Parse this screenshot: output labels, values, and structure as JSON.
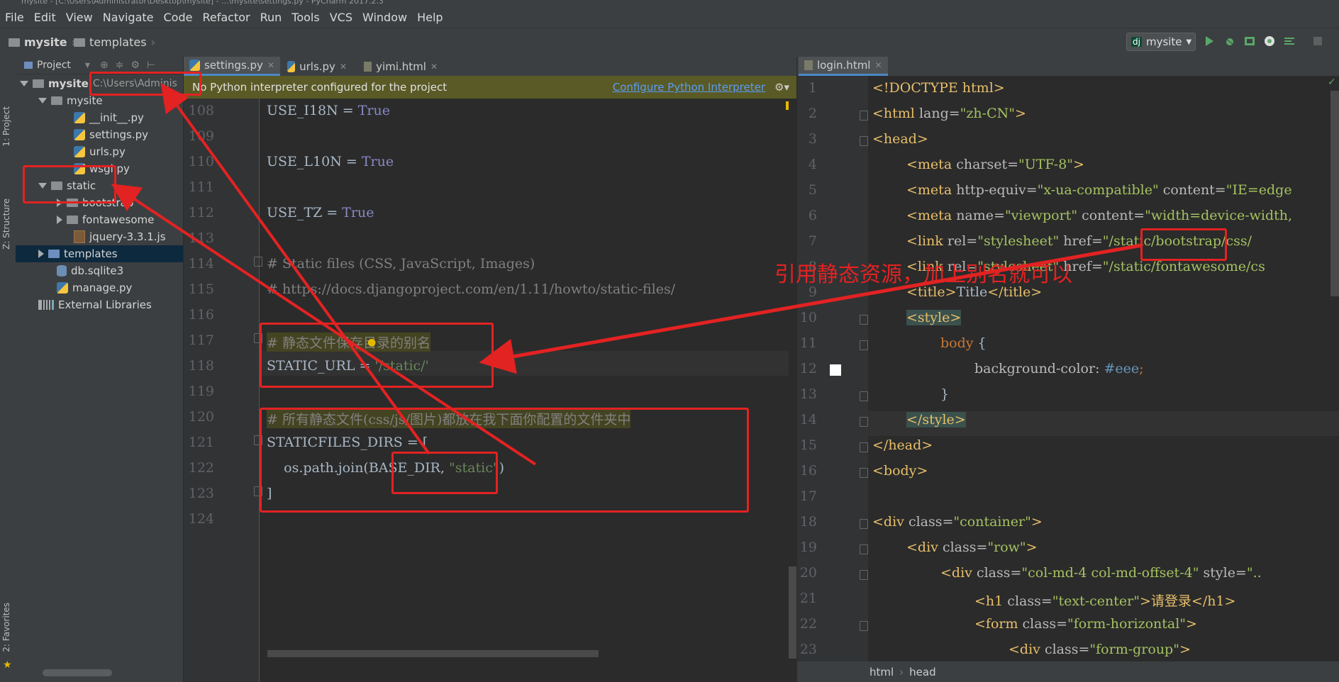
{
  "window": {
    "title": "mysite - [C:\\Users\\Administrator\\Desktop\\mysite] - ...\\mysite\\settings.py - PyCharm 2017.2.3"
  },
  "menu": [
    "File",
    "Edit",
    "View",
    "Navigate",
    "Code",
    "Refactor",
    "Run",
    "Tools",
    "VCS",
    "Window",
    "Help"
  ],
  "breadcrumb": {
    "project": "mysite",
    "folder": "templates"
  },
  "run_config": {
    "label": "mysite"
  },
  "side_tools": {
    "project": "1: Project",
    "structure": "Z: Structure",
    "favorites": "2: Favorites"
  },
  "project_panel": {
    "header": "Project",
    "root": {
      "name": "mysite",
      "path": "C:\\Users\\Adminis"
    },
    "items": [
      {
        "name": "mysite",
        "kind": "folder",
        "indent": 1,
        "expanded": true
      },
      {
        "name": "__init__.py",
        "kind": "py",
        "indent": 2
      },
      {
        "name": "settings.py",
        "kind": "py",
        "indent": 2
      },
      {
        "name": "urls.py",
        "kind": "py",
        "indent": 2
      },
      {
        "name": "wsgi.py",
        "kind": "py",
        "indent": 2
      },
      {
        "name": "static",
        "kind": "folder",
        "indent": 1,
        "expanded": true
      },
      {
        "name": "bootstrap",
        "kind": "folder",
        "indent": 2
      },
      {
        "name": "fontawesome",
        "kind": "folder",
        "indent": 2
      },
      {
        "name": "jquery-3.3.1.js",
        "kind": "js",
        "indent": 2
      },
      {
        "name": "templates",
        "kind": "folder-blue",
        "indent": 1,
        "selected": true
      },
      {
        "name": "db.sqlite3",
        "kind": "db",
        "indent": 1
      },
      {
        "name": "manage.py",
        "kind": "py",
        "indent": 1
      },
      {
        "name": "External Libraries",
        "kind": "lib",
        "indent": 0
      }
    ]
  },
  "editor_left": {
    "tabs": [
      "settings.py",
      "urls.py",
      "yimi.html"
    ],
    "notice": "No Python interpreter configured for the project",
    "notice_link": "Configure Python Interpreter",
    "line_numbers": [
      "108",
      "109",
      "110",
      "111",
      "112",
      "113",
      "114",
      "115",
      "116",
      "117",
      "118",
      "119",
      "120",
      "121",
      "122",
      "123",
      "124"
    ],
    "code": {
      "l108a": "USE_I18N = ",
      "l108b": "True",
      "l110a": "USE_L10N = ",
      "l110b": "True",
      "l112a": "USE_TZ = ",
      "l112b": "True",
      "l114": "# Static files (CSS, JavaScript, Images)",
      "l115": "# https://docs.djangoproject.com/en/1.11/howto/static-files/",
      "l117": "# 静态文件保存目录的别名",
      "l118a": "STATIC_URL = ",
      "l118b": "'/static/'",
      "l120": "# 所有静态文件(css/js/图片)都放在我下面你配置的文件夹中",
      "l121": "STATICFILES_DIRS = [",
      "l122a": "    os.path.join(BASE_DIR, ",
      "l122b": "\"static\"",
      "l122c": ")",
      "l123": "]"
    }
  },
  "editor_right": {
    "tabs": [
      "login.html"
    ],
    "line_numbers": [
      "1",
      "2",
      "3",
      "4",
      "5",
      "6",
      "7",
      "8",
      "9",
      "10",
      "11",
      "12",
      "13",
      "14",
      "15",
      "16",
      "17",
      "18",
      "19",
      "20",
      "21",
      "22",
      "23"
    ],
    "code": {
      "l1": "<!DOCTYPE html>",
      "l2a": "<html ",
      "l2b": "lang=",
      "l2c": "\"zh-CN\"",
      "l2d": ">",
      "l3": "<head>",
      "l4a": "<meta ",
      "l4b": "charset=",
      "l4c": "\"UTF-8\"",
      "l4d": ">",
      "l5a": "<meta ",
      "l5b": "http-equiv=",
      "l5c": "\"x-ua-compatible\"",
      "l5d": " content=",
      "l5e": "\"IE=edge",
      "l6a": "<meta ",
      "l6b": "name=",
      "l6c": "\"viewport\"",
      "l6d": " content=",
      "l6e": "\"width=device-width,",
      "l7a": "<link ",
      "l7b": "rel=",
      "l7c": "\"stylesheet\"",
      "l7d": " href=",
      "l7e": "\"/static/bootstrap/css/",
      "l8a": "<link ",
      "l8b": "rel=",
      "l8c": "\"stylesheet\"",
      "l8d": " href=",
      "l8e": "\"/static/fontawesome/cs",
      "l9a": "<title>",
      "l9b": "Title",
      "l9c": "</title>",
      "l10": "<style>",
      "l11a": "body",
      "l11b": " {",
      "l12a": "background-color: ",
      "l12b": "#eee",
      "l12c": ";",
      "l13": "}",
      "l14": "</style>",
      "l15": "</head>",
      "l16": "<body>",
      "l18a": "<div ",
      "l18b": "class=",
      "l18c": "\"container\"",
      "l18d": ">",
      "l19a": "<div ",
      "l19b": "class=",
      "l19c": "\"row\"",
      "l19d": ">",
      "l20a": "<div ",
      "l20b": "class=",
      "l20c": "\"col-md-4 col-md-offset-4\"",
      "l20d": " style=",
      "l20e": "\"..",
      "l21a": "<h1 ",
      "l21b": "class=",
      "l21c": "\"text-center\"",
      "l21d": ">请登录</h1>",
      "l22a": "<form ",
      "l22b": "class=",
      "l22c": "\"form-horizontal\"",
      "l22d": ">",
      "l23a": "<div ",
      "l23b": "class=",
      "l23c": "\"form-group\"",
      "l23d": ">"
    },
    "breadcrumb": [
      "html",
      "head"
    ]
  },
  "annotation": {
    "text": "引用静态资源，加上别名就可以",
    "color": "#e32222"
  }
}
